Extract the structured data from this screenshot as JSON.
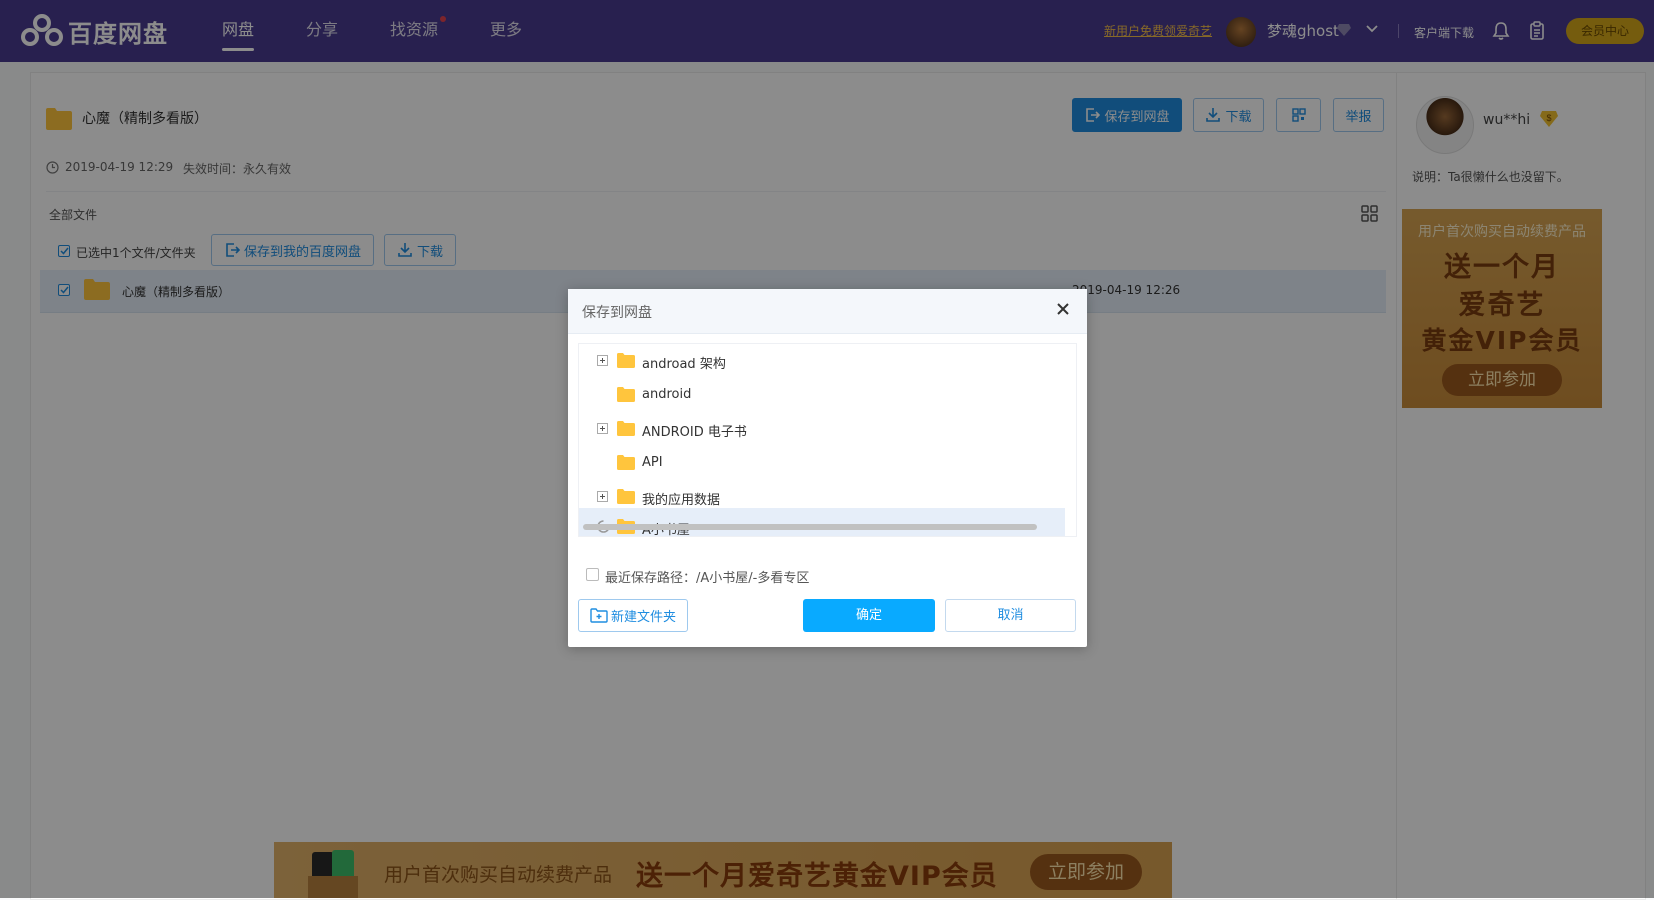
{
  "app": {
    "logo_text": "百度网盘",
    "nav": [
      "网盘",
      "分享",
      "找资源",
      "更多"
    ],
    "promo_link": "新用户免费领爱奇艺",
    "user_name": "梦魂ghost",
    "client_download": "客户端下载",
    "vip_center": "会员中心"
  },
  "share": {
    "title": "心魔（精制多看版）",
    "created": "2019-04-19 12:29",
    "expiry": "失效时间：永久有效",
    "buttons": {
      "save": "保存到网盘",
      "download": "下载",
      "report": "举报"
    }
  },
  "files": {
    "breadcrumb": "全部文件",
    "selected_text": "已选中1个文件/文件夹",
    "save_mine": "保存到我的百度网盘",
    "download": "下载",
    "rows": [
      {
        "name": "心魔（精制多看版）",
        "date": "2019-04-19 12:26"
      }
    ]
  },
  "sidebar": {
    "user": "wu**hi",
    "desc": "说明：Ta很懒什么也没留下。",
    "ad": {
      "line1": "用户首次购买自动续费产品",
      "line2": "送一个月",
      "line3": "爱奇艺",
      "line4": "黄金VIP会员",
      "button": "立即参加"
    }
  },
  "banner": {
    "lead": "用户首次购买自动续费产品",
    "headline": "送一个月爱奇艺黄金VIP会员",
    "button": "立即参加"
  },
  "dialog": {
    "title": "保存到网盘",
    "tree": [
      {
        "label": "androad 架构",
        "expandable": true
      },
      {
        "label": "android",
        "expandable": false
      },
      {
        "label": "ANDROID 电子书",
        "expandable": true
      },
      {
        "label": "API",
        "expandable": false
      },
      {
        "label": "我的应用数据",
        "expandable": true
      },
      {
        "label": "A小书屋",
        "expandable": false,
        "selected": true
      }
    ],
    "recent_path": "最近保存路径：/A小书屋/-多看专区",
    "new_folder": "新建文件夹",
    "confirm": "确定",
    "cancel": "取消"
  },
  "colors": {
    "topbar": "#4a3b90",
    "accent": "#1f8de0",
    "confirm": "#09aaff",
    "folder": "#ffc53d",
    "selected_row": "#e6effa"
  }
}
